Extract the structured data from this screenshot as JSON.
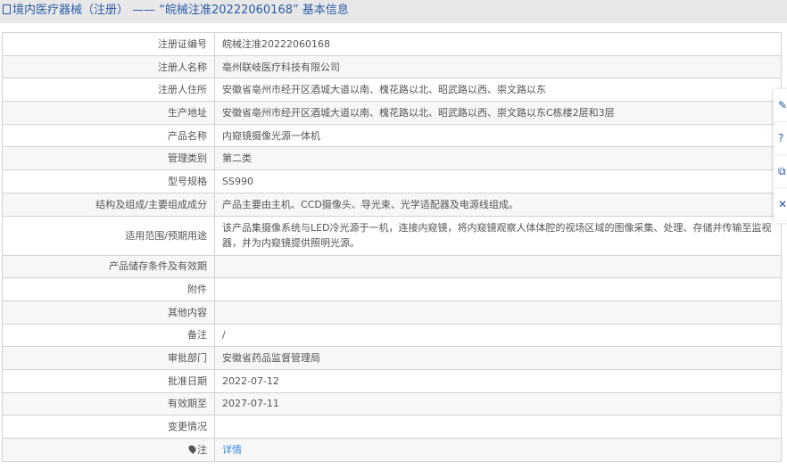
{
  "title": "境内医疗器械（注册） —— “皖械注准20222060168” 基本信息",
  "rows": [
    {
      "label": "注册证编号",
      "value": "皖械注准20222060168"
    },
    {
      "label": "注册人名称",
      "value": "亳州联岐医疗科技有限公司"
    },
    {
      "label": "注册人住所",
      "value": "安徽省亳州市经开区酒城大道以南、槐花路以北、昭武路以西、崇文路以东"
    },
    {
      "label": "生产地址",
      "value": "安徽省亳州市经开区酒城大道以南、槐花路以北、昭武路以西、崇文路以东C栋楼2层和3层"
    },
    {
      "label": "产品名称",
      "value": "内窥镜摄像光源一体机"
    },
    {
      "label": "管理类别",
      "value": "第二类"
    },
    {
      "label": "型号规格",
      "value": "SS990"
    },
    {
      "label": "结构及组成/主要组成成分",
      "value": "产品主要由主机、CCD摄像头、导光束、光学适配器及电源线组成。"
    },
    {
      "label": "适用范围/预期用途",
      "value": "该产品集摄像系统与LED冷光源于一机，连接内窥镜，将内窥镜观察人体体腔的视场区域的图像采集、处理、存储并传输至监视器，并为内窥镜提供照明光源。"
    },
    {
      "label": "产品储存条件及有效期",
      "value": ""
    },
    {
      "label": "附件",
      "value": ""
    },
    {
      "label": "其他内容",
      "value": ""
    },
    {
      "label": "备注",
      "value": "/"
    },
    {
      "label": "审批部门",
      "value": "安徽省药品监督管理局"
    },
    {
      "label": "批准日期",
      "value": "2022-07-12"
    },
    {
      "label": "有效期至",
      "value": "2027-07-11"
    },
    {
      "label": "变更情况",
      "value": ""
    }
  ],
  "note": {
    "label": "注",
    "link": "详情"
  },
  "side_icons": [
    "edit-icon",
    "help-icon",
    "share-icon",
    "close-icon"
  ]
}
